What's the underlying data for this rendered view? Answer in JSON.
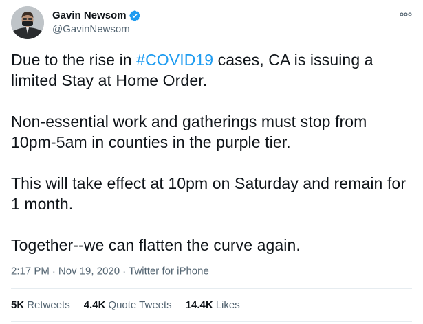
{
  "author": {
    "display_name": "Gavin Newsom",
    "handle": "@GavinNewsom",
    "verified_icon": "verified-badge-icon",
    "avatar_icon": "profile-photo"
  },
  "more_icon": "more-options-icon",
  "tweet": {
    "p1_before": "Due to the rise in ",
    "p1_hashtag": "#COVID19",
    "p1_after": " cases, CA is issuing a limited Stay at Home Order.",
    "p2": "Non-essential work and gatherings must stop from 10pm-5am in counties in the purple tier.",
    "p3": "This will take effect at 10pm on Saturday and remain for 1 month.",
    "p4": "Together--we can flatten the curve again."
  },
  "meta": {
    "time": "2:17 PM",
    "separator": "·",
    "date": "Nov 19, 2020",
    "source": "Twitter for iPhone"
  },
  "stats": {
    "retweets_count": "5K",
    "retweets_label": "Retweets",
    "quotes_count": "4.4K",
    "quotes_label": "Quote Tweets",
    "likes_count": "14.4K",
    "likes_label": "Likes"
  },
  "colors": {
    "hashtag": "#1d9bf0",
    "verified": "#1d9bf0",
    "secondary_text": "#536471",
    "primary_text": "#0f1419"
  }
}
